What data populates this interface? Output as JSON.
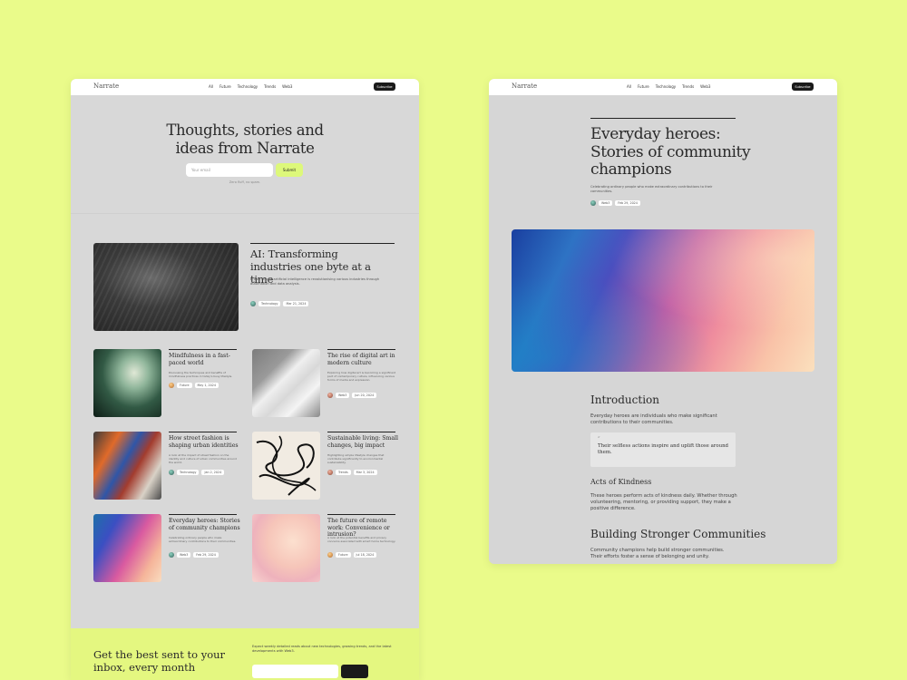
{
  "left": {
    "nav": {
      "logo": "Narrate",
      "links": [
        "All",
        "Future",
        "Technology",
        "Trends",
        "Web3"
      ],
      "subscribe": "Subscribe"
    },
    "hero": {
      "title_line1": "Thoughts, stories and",
      "title_line2": "ideas from Narrate",
      "email_placeholder": "Your email",
      "submit": "Submit",
      "note": "Zero fluff, no spam."
    },
    "featured": {
      "title_line1": "AI: Transforming",
      "title_line2": "industries one byte at a time",
      "desc": "A look at how artificial intelligence is revolutionising various industries through automation and data analysis.",
      "category": "Technology",
      "date": "Mar 21, 2024"
    },
    "posts": [
      {
        "title": "Mindfulness in a fast-paced world",
        "desc": "Discussing the techniques and benefits of mindfulness practices in today's busy lifestyle.",
        "category": "Future",
        "date": "May 1, 2024"
      },
      {
        "title": "The rise of digital art in modern culture",
        "desc": "Exploring how digital art is becoming a significant part of contemporary culture, influencing various forms of media and expression.",
        "category": "Web3",
        "date": "Jun 20, 2024"
      },
      {
        "title": "How street fashion is shaping urban identities",
        "desc": "A look at the impact of street fashion on the identity and culture of urban communities around the world.",
        "category": "Technology",
        "date": "Jan 2, 2024"
      },
      {
        "title": "Sustainable living: Small changes, big impact",
        "desc": "Highlighting simple lifestyle changes that contribute significantly to environmental sustainability.",
        "category": "Trends",
        "date": "Mar 3, 2024"
      },
      {
        "title": "Everyday heroes: Stories of community champions",
        "desc": "Celebrating ordinary people who make extraordinary contributions to their communities.",
        "category": "Web3",
        "date": "Feb 29, 2024"
      },
      {
        "title": "The future of remote work: Convenience or intrusion?",
        "desc": "A look at the potential benefits and privacy concerns associated with smart home technology.",
        "category": "Future",
        "date": "Jul 18, 2024"
      }
    ],
    "newsletter": {
      "title_line1": "Get the best sent to your",
      "title_line2": "inbox, every month",
      "desc": "Expect weekly detailed reads about new technologies, growing trends, and the latest developments with Web3."
    }
  },
  "right": {
    "nav": {
      "logo": "Narrate",
      "links": [
        "All",
        "Future",
        "Technology",
        "Trends",
        "Web3"
      ],
      "subscribe": "Subscribe"
    },
    "article": {
      "title_line1": "Everyday heroes:",
      "title_line2": "Stories of community",
      "title_line3": "champions",
      "desc": "Celebrating ordinary people who make extraordinary contributions to their communities.",
      "category": "Web3",
      "date": "Feb 29, 2024",
      "intro_heading": "Introduction",
      "intro_text": "Everyday heroes are individuals who make significant contributions to their communities.",
      "quote": "Their selfless actions inspire and uplift those around them.",
      "kindness_heading": "Acts of Kindness",
      "kindness_text": "These heroes perform acts of kindness daily. Whether through volunteering, mentoring, or providing support, they make a positive difference.",
      "building_heading": "Building Stronger Communities",
      "building_text": "Community champions help build stronger communities. Their efforts foster a sense of belonging and unity."
    }
  }
}
